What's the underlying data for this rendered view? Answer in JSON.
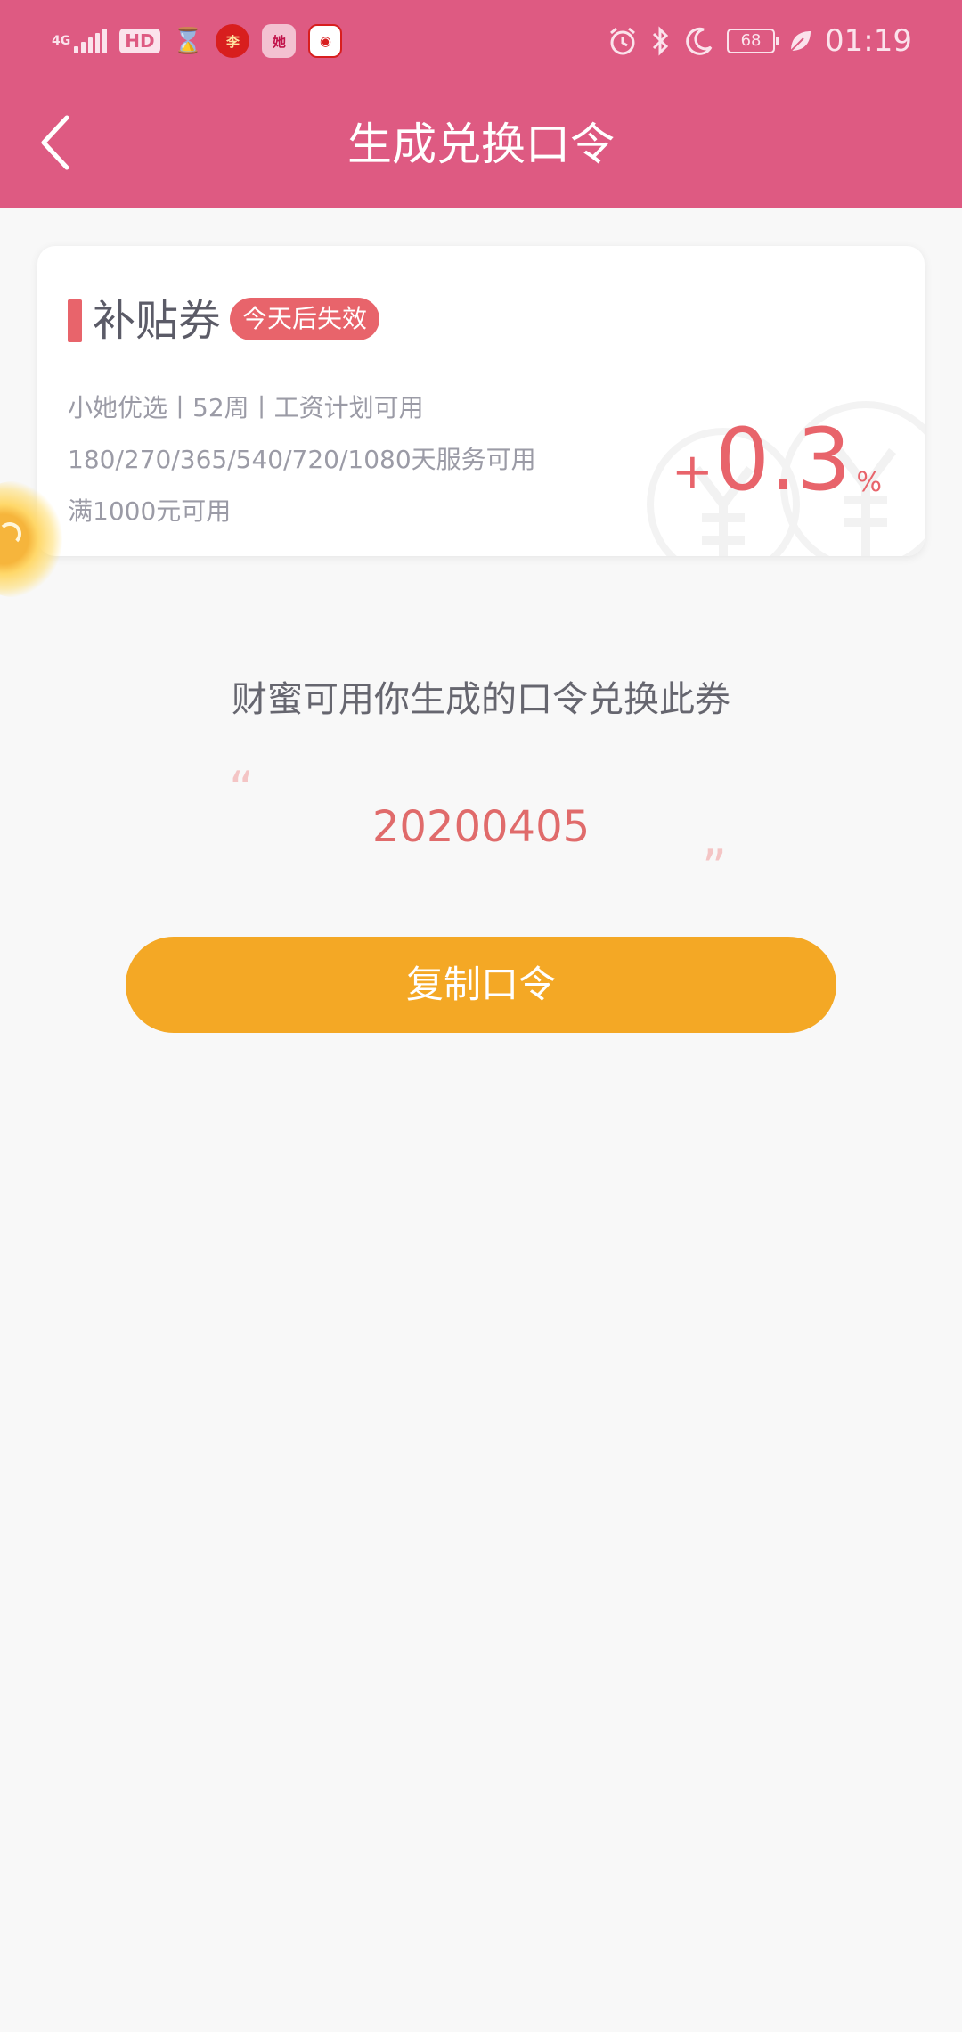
{
  "status_bar": {
    "network": "4G",
    "hd_label": "HD",
    "battery": "68",
    "time": "01:19",
    "icons": [
      "signal-icon",
      "hd-icon",
      "hourglass-icon",
      "app-notification-icon",
      "app-notification-icon",
      "app-notification-icon",
      "alarm-icon",
      "bluetooth-icon",
      "moon-icon",
      "battery-icon",
      "leaf-icon"
    ],
    "app_badges": [
      "李",
      "她",
      "◉"
    ]
  },
  "header": {
    "title": "生成兑换口令",
    "back_icon": "chevron-left-icon",
    "bg_color": "#de5a82"
  },
  "coupon": {
    "name": "补贴券",
    "expiry_badge": "今天后失效",
    "product_line": "小她优选丨52周丨工资计划可用",
    "terms_line": "180/270/365/540/720/1080天服务可用",
    "min_amount_line": "满1000元可用",
    "rate_sign": "+",
    "rate_value": "0.3",
    "rate_unit": "%",
    "accent_color": "#e8646b"
  },
  "main": {
    "instruction": "财蜜可用你生成的口令兑换此券",
    "quote_open": "“",
    "quote_close": "”",
    "code": "20200405",
    "copy_button_label": "复制口令",
    "button_color": "#f4a825"
  }
}
